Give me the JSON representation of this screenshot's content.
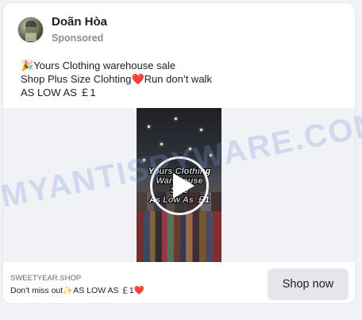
{
  "post": {
    "author": "Doãn Hòa",
    "sponsored_label": "Sponsored",
    "text_lines": [
      {
        "emoji": "🎉",
        "text": "Yours Clothing warehouse sale"
      },
      {
        "pre": "Shop Plus Size Clohting",
        "emoji": "❤️",
        "post": "Run don’t walk"
      },
      {
        "text": "AS LOW AS ￡1"
      }
    ]
  },
  "video": {
    "overlay_line1": "Yours Clothing",
    "overlay_line2": "Warehouse Sale",
    "overlay_line3": "As Low As ￡1",
    "icon": "play-icon"
  },
  "footer": {
    "domain": "SWEETYEAR.SHOP",
    "headline_pre": "Don't miss out",
    "sparkle_emoji": "✨",
    "headline_mid": "AS LOW AS ￡1",
    "heart_emoji": "❤️",
    "cta_label": "Shop now"
  },
  "watermark": "MYANTISPYWARE.COM",
  "colors": {
    "background": "#f0f2f5",
    "card": "#ffffff",
    "button_bg": "#e4e6eb",
    "secondary_text": "#65676b",
    "watermark": "#7896dc"
  }
}
